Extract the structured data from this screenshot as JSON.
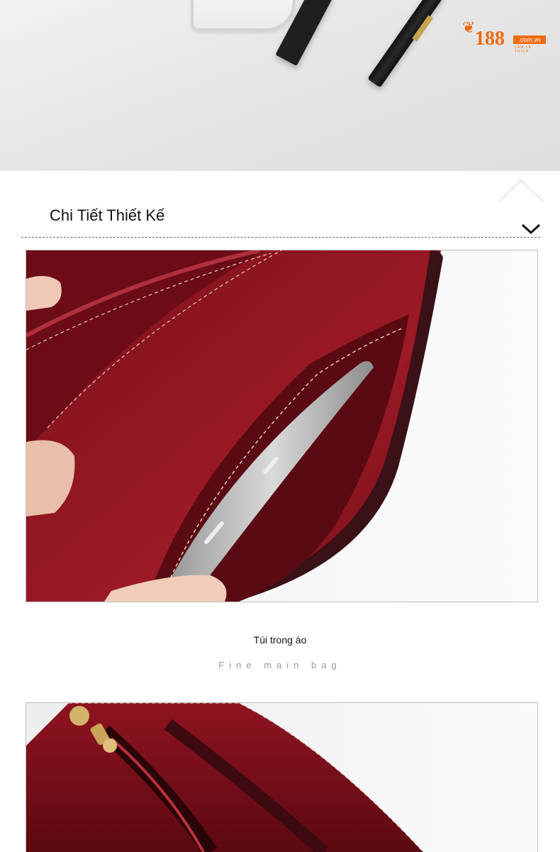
{
  "brand": {
    "logo_number": "188",
    "logo_domain": ".com.vn",
    "logo_tagline": "LÀM LÀ THÍCH",
    "accent_color": "#f06a0f"
  },
  "section": {
    "title": "Chi Tiết Thiết Kế",
    "toggle_icon": "chevron-down-icon"
  },
  "photos": [
    {
      "subject": "top-product-photo"
    },
    {
      "subject": "red-bag-interior-with-phone"
    },
    {
      "subject": "red-bag-zipper-pocket"
    }
  ],
  "captions": {
    "main": "Túi trong áo",
    "sub": "Fine main bag"
  },
  "colors": {
    "bag_red": "#8e1420",
    "bag_dark": "#5a0a12",
    "divider": "#666666"
  }
}
